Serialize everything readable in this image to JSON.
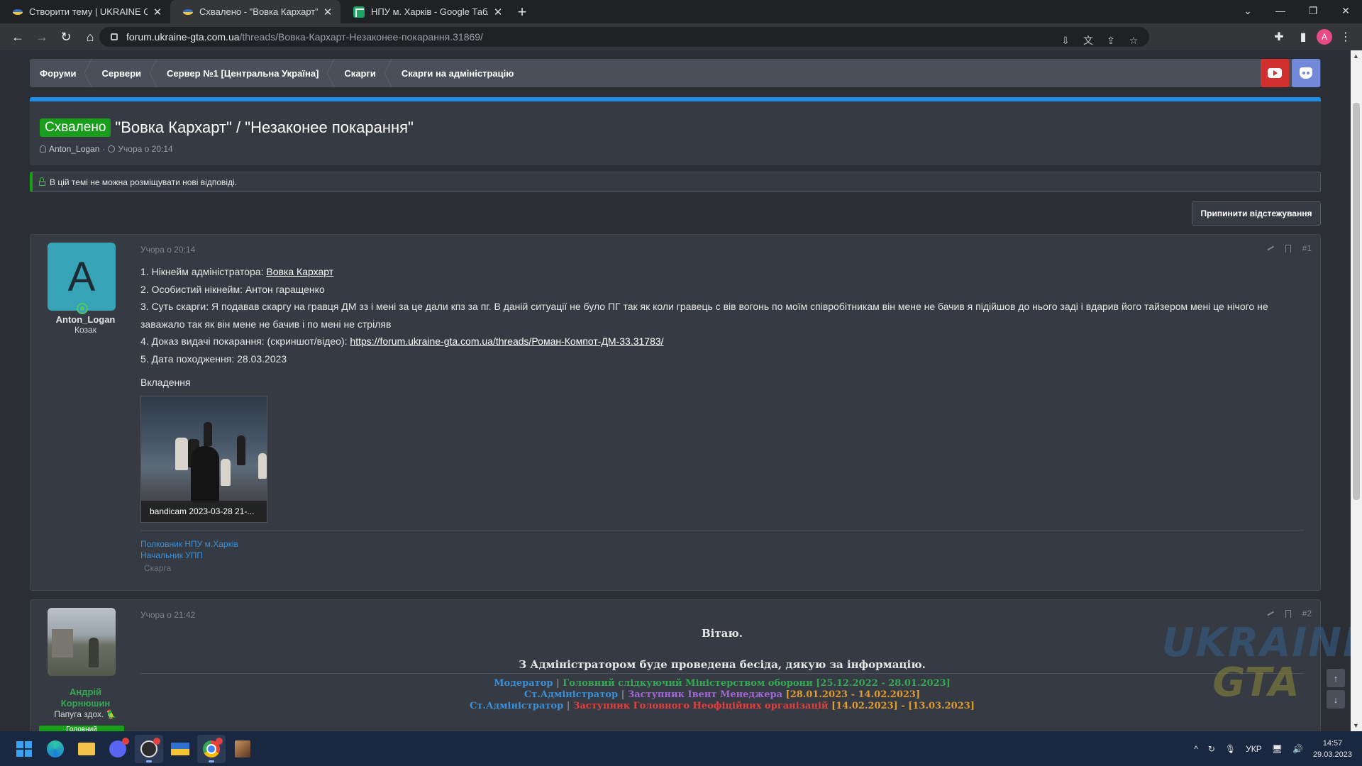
{
  "browser": {
    "tabs": [
      {
        "title": "Створити тему | UKRAINE GTA -",
        "icon": "ukraine-gta-favicon"
      },
      {
        "title": "Схвалено - \"Вовка Кархарт\" / \"Н",
        "icon": "ukraine-gta-favicon",
        "active": true
      },
      {
        "title": "НПУ м. Харків - Google Таблиця",
        "icon": "google-sheets-favicon"
      }
    ],
    "url_host": "forum.ukraine-gta.com.ua",
    "url_path": "/threads/Вовка-Кархарт-Незаконее-покарання.31869/",
    "profile_initial": "A"
  },
  "breadcrumbs": [
    {
      "label": "Форуми"
    },
    {
      "label": "Сервери"
    },
    {
      "label": "Сервер №1 [Центральна Україна]"
    },
    {
      "label": "Скарги"
    },
    {
      "label": "Скарги на адміністрацію",
      "current": true
    }
  ],
  "thread": {
    "prefix": "Схвалено",
    "title": "\"Вовка Кархарт\" / \"Незаконее покарання\"",
    "author": "Anton_Logan",
    "date": "Учора о 20:14",
    "locked_notice": "В цій темі не можна розміщувати нові відповіді.",
    "unwatch_label": "Припинити відстежування"
  },
  "post1": {
    "avatar_letter": "A",
    "username": "Anton_Logan",
    "user_title": "Козак",
    "date": "Учора о 20:14",
    "number": "#1",
    "lines": {
      "l1_label": "1. Нікнейм адміністратора: ",
      "l1_value": "Вовка Кархарт",
      "l2": "2. Особистий нікнейм: Антон гаращенко",
      "l3": "3. Суть скарги: Я подавав скаргу на гравця ДМ зз і мені за це дали кпз за пг. В даній ситуації не було ПГ так як коли гравець с вів вогонь по моїм співробітникам він мене не бачив я підійшов до нього заді і вдарив його тайзером мені це нічого не заважало так як він мене не бачив і по мені не стріляв",
      "l4_label": "4. Доказ видачі покарання: (скриншот/відео): ",
      "l4_link": "https://forum.ukraine-gta.com.ua/threads/Роман-Компот-ДМ-33.31783/",
      "l5": "5. Дата походження: 28.03.2023"
    },
    "attachments_heading": "Вкладення",
    "attachment_caption": "bandicam 2023-03-28 21-...",
    "signature": [
      "Полковник НПУ м.Харків",
      "Начальник УПП"
    ],
    "tag": "Скарга"
  },
  "post2": {
    "username_line1": "Андрій",
    "username_line2": "Корнюшин",
    "user_title": "Папуга здох. 🦜",
    "staff_badge": "Головний",
    "date": "Учора о 21:42",
    "number": "#2",
    "greeting": "Вітаю.",
    "message": "З Адміністратором буде проведена бесіда, дякую за інформацію.",
    "signature": {
      "r1_a": "Модератор",
      "r1_sep": " | ",
      "r1_b": "Головний слідкуючий Міністерством оборони",
      "r1_c": " [25.12.2022 - 28.01.2023]",
      "r2_a": "Ст.Адміністратор",
      "r2_sep": " | ",
      "r2_b": "Заступник Івент Менеджера",
      "r2_c": " [28.01.2023 - 14.02.2023]",
      "r3_a": "Ст.Адміністратор",
      "r3_sep": " | ",
      "r3_b": "Заступник Головного Неофіційних організацій",
      "r3_c": " [14.02.2023] - [13.03.2023]"
    }
  },
  "watermark": {
    "line1": "UKRAINE",
    "line2": "GTA"
  },
  "taskbar": {
    "language": "УКР",
    "time": "14:57",
    "date": "29.03.2023"
  },
  "colors": {
    "accent_blue": "#1c8ee8",
    "approved_green": "#199e1b",
    "youtube_red": "#d0302e",
    "discord_blurple": "#7289da"
  }
}
